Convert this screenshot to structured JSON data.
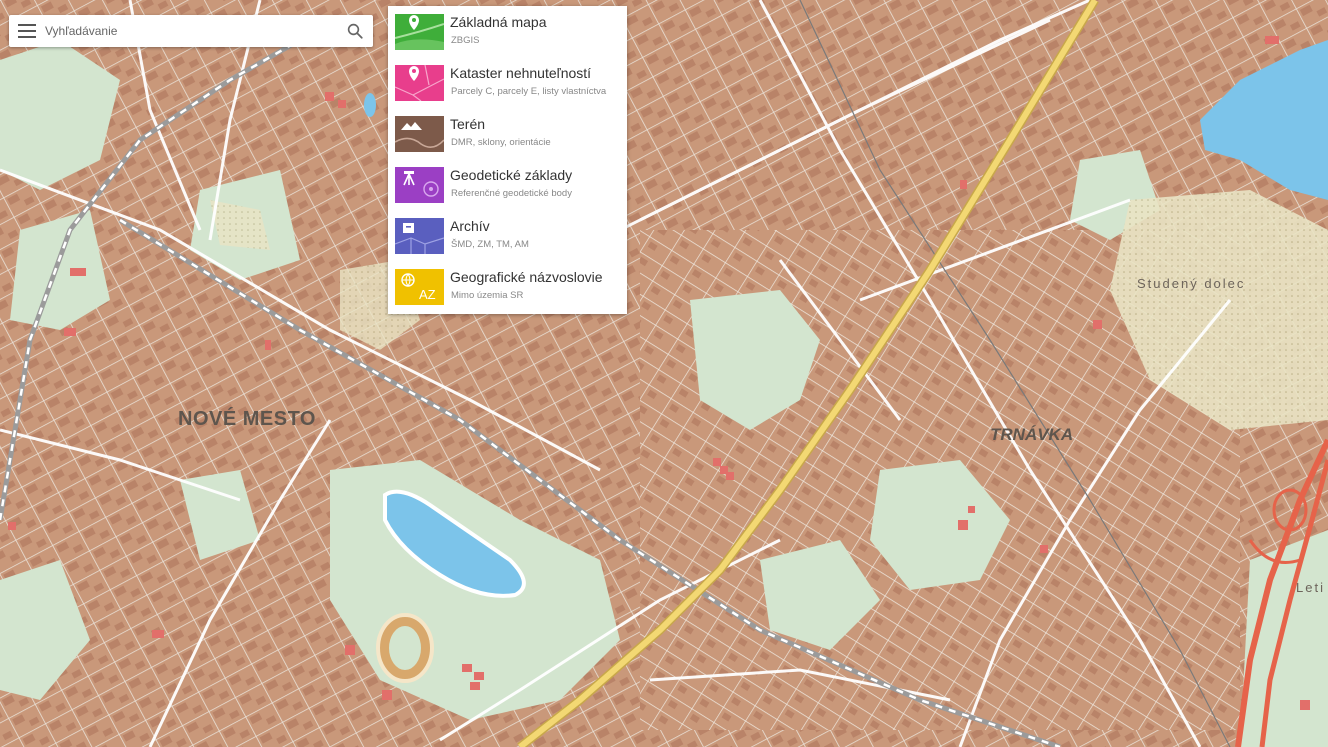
{
  "search": {
    "placeholder": "Vyhľadávanie",
    "value": ""
  },
  "layers": [
    {
      "title": "Základná mapa",
      "subtitle": "ZBGIS",
      "color": "#3fae3a",
      "icon": "map-pin-icon"
    },
    {
      "title": "Kataster nehnuteľností",
      "subtitle": "Parcely C, parcely E, listy vlastníctva",
      "color": "#e83e8c",
      "icon": "parcel-pin-icon"
    },
    {
      "title": "Terén",
      "subtitle": "DMR, sklony, orientácie",
      "color": "#7d5a4a",
      "icon": "mountain-icon"
    },
    {
      "title": "Geodetické základy",
      "subtitle": "Referenčné geodetické body",
      "color": "#9b3fc4",
      "icon": "survey-tripod-icon"
    },
    {
      "title": "Archív",
      "subtitle": "ŠMD, ZM, TM, AM",
      "color": "#5a5fbf",
      "icon": "archive-box-icon"
    },
    {
      "title": "Geografické názvoslovie",
      "subtitle": "Mimo územia SR",
      "color": "#f0c100",
      "icon": "globe-az-icon"
    }
  ],
  "map_labels": {
    "nove_mesto": "NOVÉ MESTO",
    "trnavka": "TRNÁVKA",
    "studeny_dolec": "Studený dolec",
    "leti": "Leti"
  },
  "colors": {
    "built_area": "#c9987a",
    "green_area": "#d3e5cf",
    "water": "#7cc4ea",
    "road": "#ffffff",
    "main_road": "#f3d873",
    "motorway": "#e6634a",
    "railway": "#9b9b9b"
  }
}
